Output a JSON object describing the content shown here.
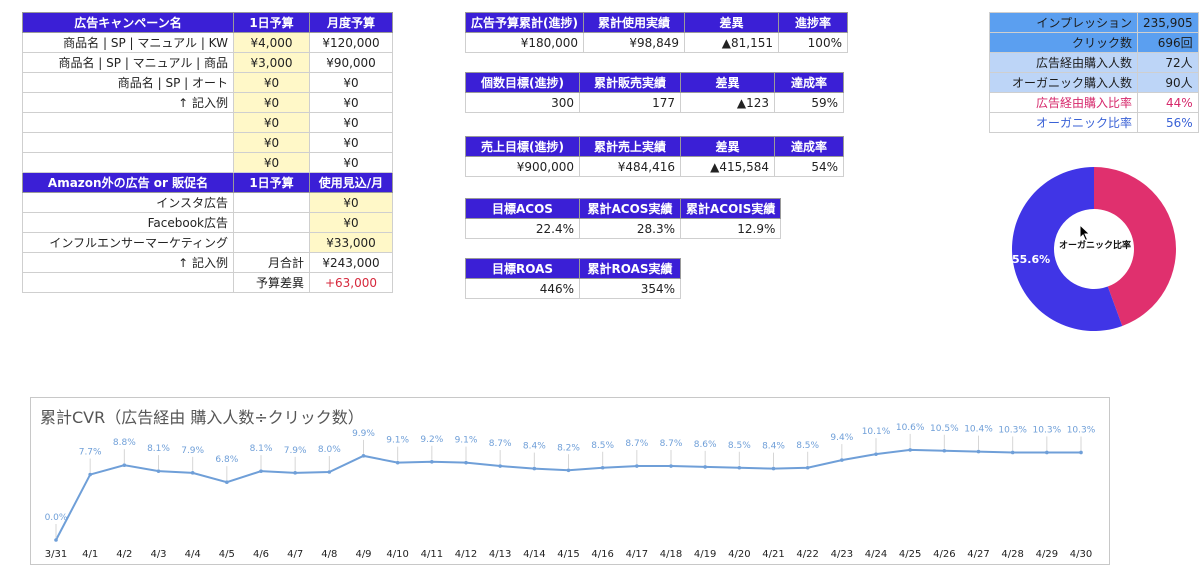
{
  "campaign": {
    "headers": [
      "広告キャンペーン名",
      "1日予算",
      "月度予算"
    ],
    "rows": [
      [
        "商品名 | SP | マニュアル | KW",
        "¥4,000",
        "¥120,000"
      ],
      [
        "商品名 | SP | マニュアル | 商品",
        "¥3,000",
        "¥90,000"
      ],
      [
        "商品名 | SP | オート",
        "¥0",
        "¥0"
      ],
      [
        "↑ 記入例",
        "¥0",
        "¥0"
      ],
      [
        "",
        "¥0",
        "¥0"
      ],
      [
        "",
        "¥0",
        "¥0"
      ],
      [
        "",
        "¥0",
        "¥0"
      ]
    ],
    "headers2": [
      "Amazon外の広告 or 販促名",
      "1日予算",
      "使用見込/月"
    ],
    "rows2": [
      [
        "インスタ広告",
        "",
        "¥0"
      ],
      [
        "Facebook広告",
        "",
        "¥0"
      ],
      [
        "インフルエンサーマーケティング",
        "",
        "¥33,000"
      ],
      [
        "↑ 記入例",
        "月合計",
        "¥243,000"
      ],
      [
        "",
        "予算差異",
        "+63,000"
      ]
    ]
  },
  "kpi": {
    "budget": {
      "headers": [
        "広告予算累計(進捗)",
        "累計使用実績",
        "差異",
        "進捗率"
      ],
      "values": [
        "¥180,000",
        "¥98,849",
        "▲81,151",
        "100%"
      ]
    },
    "units": {
      "headers": [
        "個数目標(進捗)",
        "累計販売実績",
        "差異",
        "達成率"
      ],
      "values": [
        "300",
        "177",
        "▲123",
        "59%"
      ]
    },
    "sales": {
      "headers": [
        "売上目標(進捗)",
        "累計売上実績",
        "差異",
        "達成率"
      ],
      "values": [
        "¥900,000",
        "¥484,416",
        "▲415,584",
        "54%"
      ]
    },
    "acos": {
      "headers": [
        "目標ACOS",
        "累計ACOS実績",
        "累計ACOIS実績"
      ],
      "values": [
        "22.4%",
        "28.3%",
        "12.9%"
      ]
    },
    "roas": {
      "headers": [
        "目標ROAS",
        "累計ROAS実績"
      ],
      "values": [
        "446%",
        "354%"
      ]
    }
  },
  "stats": {
    "rows": [
      [
        "インプレッション",
        "235,905"
      ],
      [
        "クリック数",
        "696回"
      ],
      [
        "広告経由購入人数",
        "72人"
      ],
      [
        "オーガニック購入人数",
        "90人"
      ],
      [
        "広告経由購入比率",
        "44%"
      ],
      [
        "オーガニック比率",
        "56%"
      ]
    ]
  },
  "donut": {
    "center_label": "オーガニック比率",
    "pct_label": "55.6%",
    "organic_pct": 55.6,
    "organic_color": "#4035e6",
    "ad_color": "#e0306e"
  },
  "chart_data": {
    "type": "line",
    "title": "累計CVR（広告経由 購入人数÷クリック数）",
    "categories": [
      "3/31",
      "4/1",
      "4/2",
      "4/3",
      "4/4",
      "4/5",
      "4/6",
      "4/7",
      "4/8",
      "4/9",
      "4/10",
      "4/11",
      "4/12",
      "4/13",
      "4/14",
      "4/15",
      "4/16",
      "4/17",
      "4/18",
      "4/19",
      "4/20",
      "4/21",
      "4/22",
      "4/23",
      "4/24",
      "4/25",
      "4/26",
      "4/27",
      "4/28",
      "4/29",
      "4/30"
    ],
    "values": [
      0.0,
      7.7,
      8.8,
      8.1,
      7.9,
      6.8,
      8.1,
      7.9,
      8.0,
      9.9,
      9.1,
      9.2,
      9.1,
      8.7,
      8.4,
      8.2,
      8.5,
      8.7,
      8.7,
      8.6,
      8.5,
      8.4,
      8.5,
      9.4,
      10.1,
      10.6,
      10.5,
      10.4,
      10.3,
      10.3,
      10.3
    ],
    "labels": [
      "0.0%",
      "7.7%",
      "8.8%",
      "8.1%",
      "7.9%",
      "6.8%",
      "8.1%",
      "7.9%",
      "8.0%",
      "9.9%",
      "9.1%",
      "9.2%",
      "9.1%",
      "8.7%",
      "8.4%",
      "8.2%",
      "8.5%",
      "8.7%",
      "8.7%",
      "8.6%",
      "8.5%",
      "8.4%",
      "8.5%",
      "9.4%",
      "10.1%",
      "10.6%",
      "10.5%",
      "10.4%",
      "10.3%",
      "10.3%",
      "10.3%"
    ],
    "line_color": "#6f9fd8",
    "grid": false
  }
}
